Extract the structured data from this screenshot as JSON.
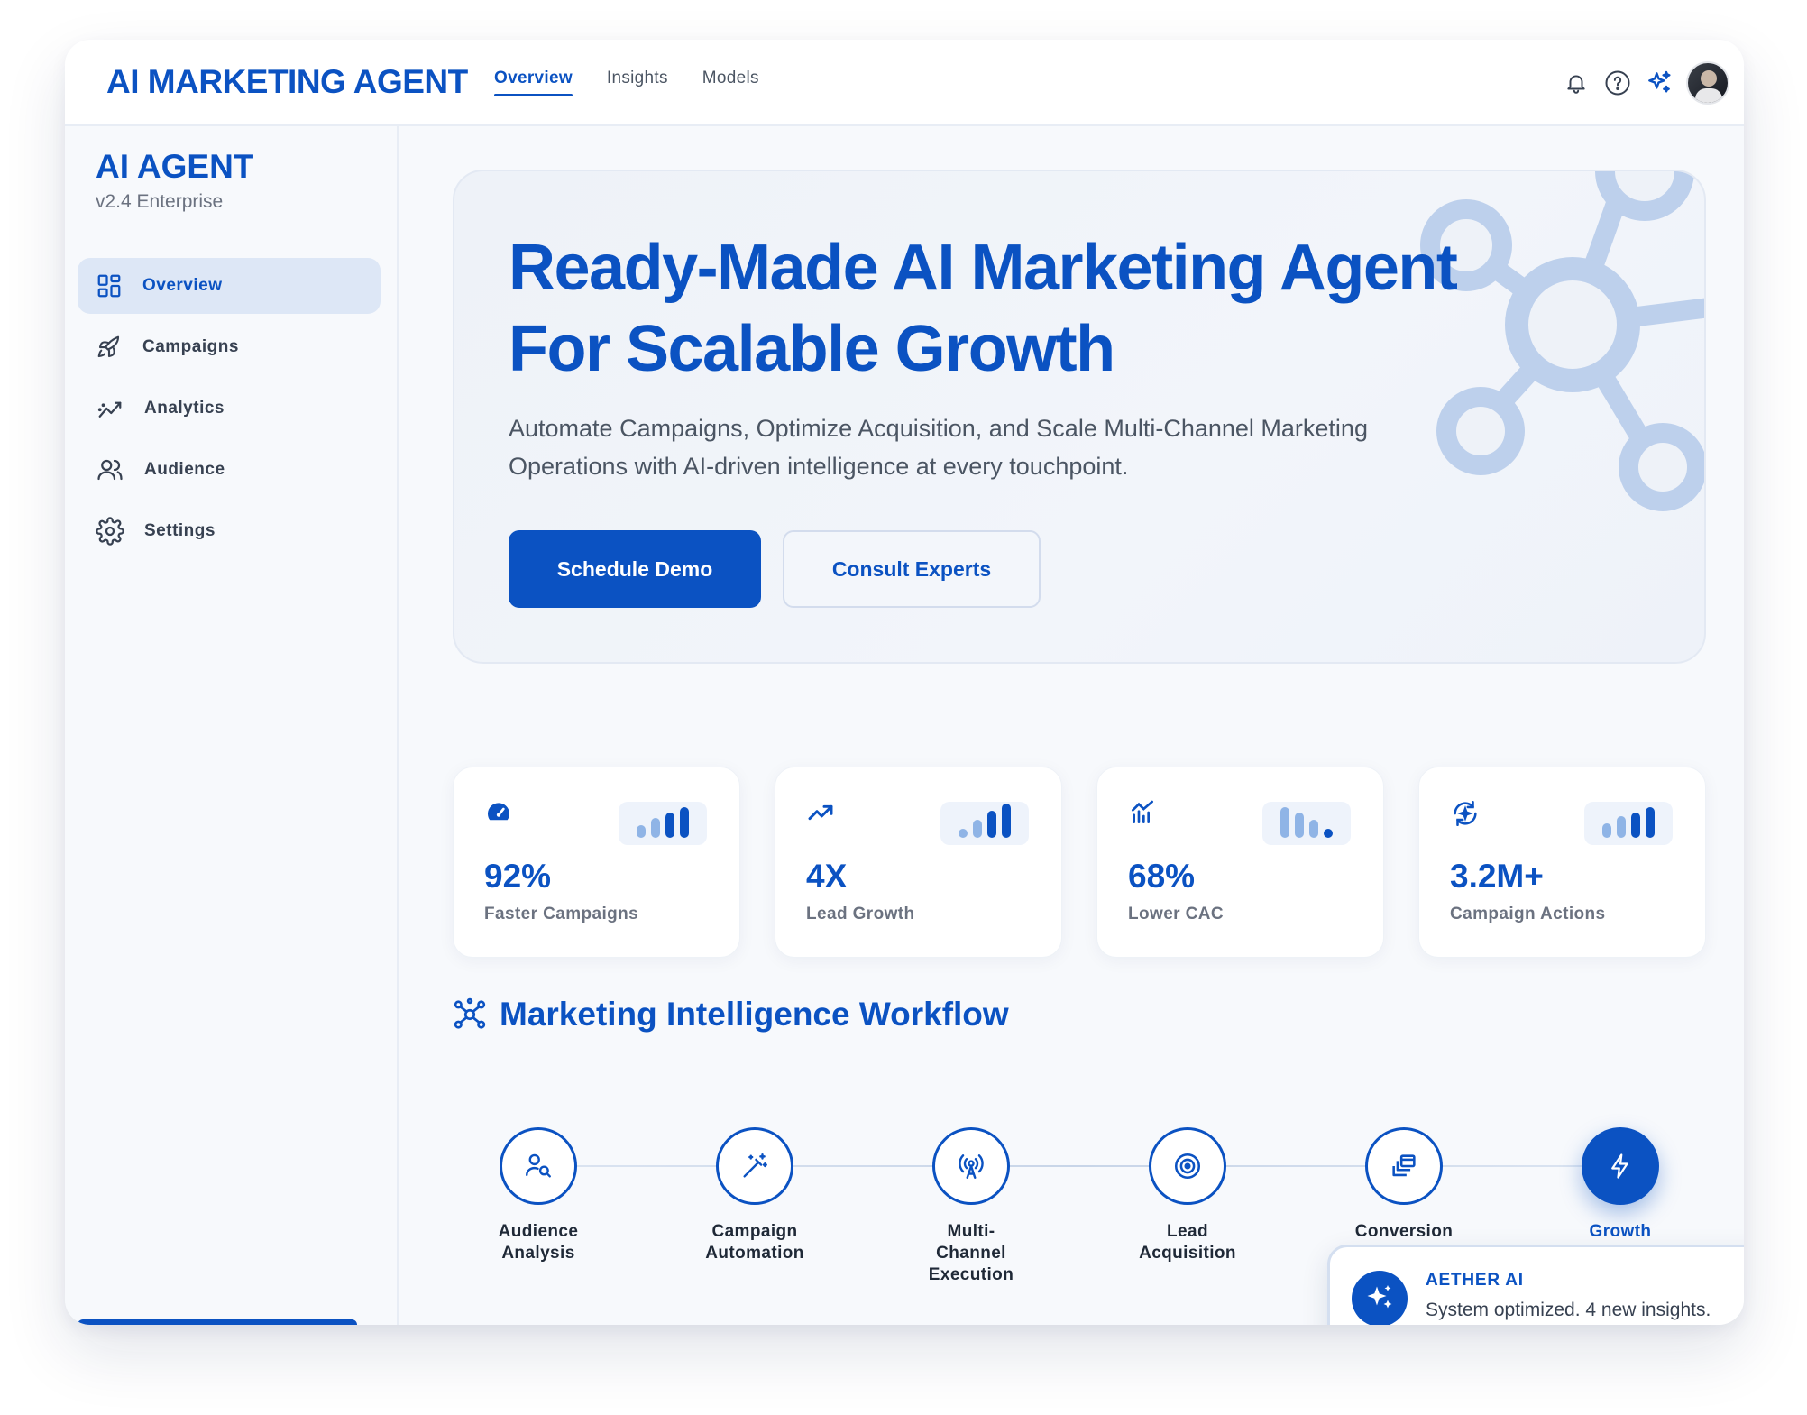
{
  "topbar": {
    "brand": "AI MARKETING AGENT",
    "tabs": [
      {
        "label": "Overview",
        "active": true
      },
      {
        "label": "Insights",
        "active": false
      },
      {
        "label": "Models",
        "active": false
      }
    ],
    "icons": [
      "bell-icon",
      "help-icon",
      "sparkles-icon",
      "avatar"
    ]
  },
  "sidebar": {
    "title": "AI AGENT",
    "subtitle": "v2.4 Enterprise",
    "items": [
      {
        "label": "Overview",
        "icon": "dashboard-icon",
        "active": true
      },
      {
        "label": "Campaigns",
        "icon": "rocket-icon",
        "active": false
      },
      {
        "label": "Analytics",
        "icon": "analytics-icon",
        "active": false
      },
      {
        "label": "Audience",
        "icon": "users-icon",
        "active": false
      },
      {
        "label": "Settings",
        "icon": "gear-icon",
        "active": false
      }
    ]
  },
  "hero": {
    "title_line1": "Ready-Made AI Marketing Agent",
    "title_line2": "For Scalable Growth",
    "description": "Automate Campaigns, Optimize Acquisition, and Scale Multi-Channel Marketing Operations with AI-driven intelligence at every touchpoint.",
    "primary_button": "Schedule Demo",
    "secondary_button": "Consult Experts"
  },
  "stats": [
    {
      "value": "92%",
      "label": "Faster Campaigns",
      "icon": "speedometer-icon"
    },
    {
      "value": "4X",
      "label": "Lead Growth",
      "icon": "trending-up-icon"
    },
    {
      "value": "68%",
      "label": "Lower CAC",
      "icon": "bar-chart-icon"
    },
    {
      "value": "3.2M+",
      "label": "Campaign Actions",
      "icon": "refresh-sparkle-icon"
    }
  ],
  "workflow": {
    "title": "Marketing Intelligence Workflow",
    "steps": [
      {
        "label_line1": "Audience",
        "label_line2": "Analysis",
        "label_line3": "",
        "icon": "user-search-icon",
        "active": false
      },
      {
        "label_line1": "Campaign",
        "label_line2": "Automation",
        "label_line3": "",
        "icon": "magic-wand-icon",
        "active": false
      },
      {
        "label_line1": "Multi-",
        "label_line2": "Channel",
        "label_line3": "Execution",
        "icon": "broadcast-icon",
        "active": false
      },
      {
        "label_line1": "Lead",
        "label_line2": "Acquisition",
        "label_line3": "",
        "icon": "target-icon",
        "active": false
      },
      {
        "label_line1": "Conversion",
        "label_line2": "",
        "label_line3": "",
        "icon": "layers-icon",
        "active": false
      },
      {
        "label_line1": "Growth",
        "label_line2": "",
        "label_line3": "",
        "icon": "bolt-icon",
        "active": true
      }
    ]
  },
  "toast": {
    "title": "AETHER AI",
    "message": "System optimized. 4 new insights."
  },
  "colors": {
    "brand": "#0b52c2",
    "background": "#f7f9fc",
    "active_nav_bg": "#dde7f6",
    "muted_text": "#6b7280"
  }
}
